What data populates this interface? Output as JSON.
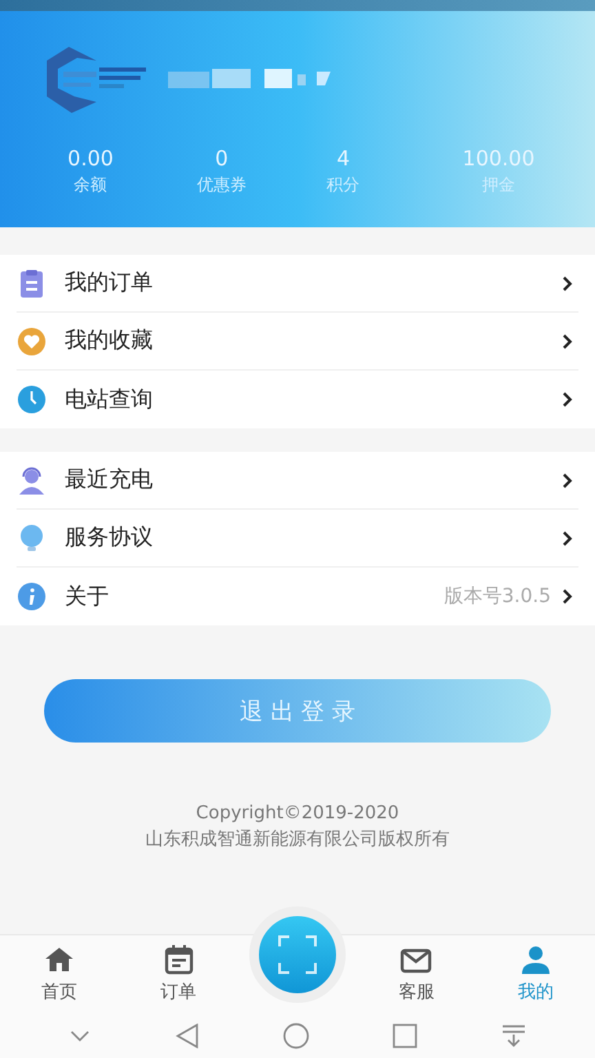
{
  "profile": {
    "stats": [
      {
        "value": "0.00",
        "label": "余额"
      },
      {
        "value": "0",
        "label": "优惠券"
      },
      {
        "value": "4",
        "label": "积分"
      },
      {
        "value": "100.00",
        "label": "押金"
      }
    ]
  },
  "menu_groups": [
    {
      "items": [
        {
          "label": "我的订单"
        },
        {
          "label": "我的收藏"
        },
        {
          "label": "电站查询"
        }
      ]
    },
    {
      "items": [
        {
          "label": "最近充电"
        },
        {
          "label": "服务协议"
        },
        {
          "label": "关于",
          "detail": "版本号3.0.5"
        }
      ]
    }
  ],
  "logout_button": "退 出 登 录",
  "footer": {
    "copyright": "Copyright©2019-2020",
    "company": "山东积成智通新能源有限公司版权所有"
  },
  "tab_bar": [
    {
      "label": "首页",
      "selected": false
    },
    {
      "label": "订单",
      "selected": false
    },
    {
      "label": "客服",
      "selected": false
    },
    {
      "label": "我的",
      "selected": true
    }
  ]
}
